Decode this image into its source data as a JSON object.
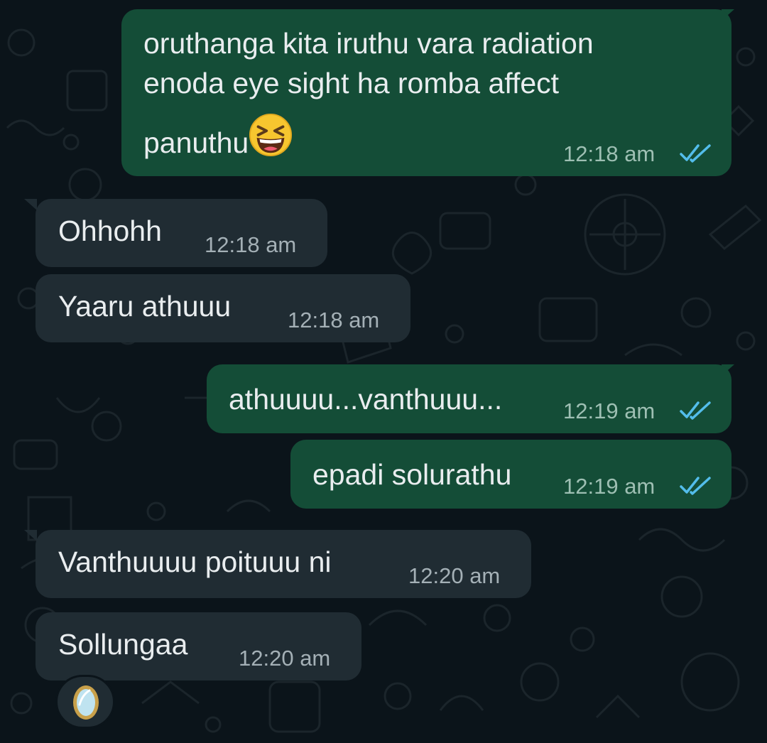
{
  "chat": {
    "messages": [
      {
        "direction": "outgoing",
        "lines": [
          "oruthanga kita iruthu vara radiation",
          "enoda eye sight ha romba affect",
          "panuthu"
        ],
        "emoji": "grinning-squinting-face",
        "time": "12:18 am",
        "status": "read"
      },
      {
        "direction": "incoming",
        "text": "Ohhohh",
        "time": "12:18 am"
      },
      {
        "direction": "incoming",
        "text": "Yaaru athuuu",
        "time": "12:18 am"
      },
      {
        "direction": "outgoing",
        "text": "athuuuu...vanthuuu...",
        "time": "12:19 am",
        "status": "read"
      },
      {
        "direction": "outgoing",
        "text": "epadi solurathu",
        "time": "12:19 am",
        "status": "read"
      },
      {
        "direction": "incoming",
        "text": "Vanthuuuu poituuu ni",
        "time": "12:20 am"
      },
      {
        "direction": "incoming",
        "text": "Sollungaa",
        "time": "12:20 am",
        "reaction": "mirror-emoji"
      }
    ]
  },
  "colors": {
    "background": "#0b141a",
    "outgoing_bubble": "#144d37",
    "incoming_bubble": "#202c33",
    "text": "#e9edef",
    "timestamp": "#a4b0b6",
    "read_ticks": "#53bdeb"
  }
}
